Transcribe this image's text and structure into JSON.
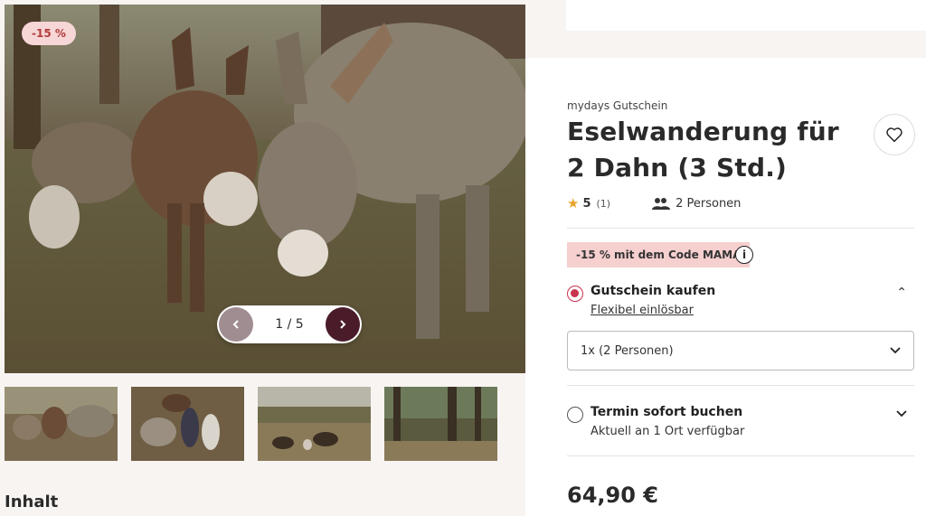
{
  "gallery": {
    "badge": "-15 %",
    "counter": "1 / 5",
    "prev_icon": "chevron-left-icon",
    "next_icon": "chevron-right-icon",
    "thumbnails": [
      "donkeys-grazing",
      "people-with-donkeys",
      "donkeys-in-field",
      "forest-path"
    ]
  },
  "content": {
    "section_title": "Inhalt"
  },
  "product": {
    "brand": "mydays Gutschein",
    "title": "Eselwanderung für 2 Dahn (3 Std.)",
    "wishlist_icon": "heart-icon",
    "rating_value": "5",
    "rating_count": "(1)",
    "persons": "2 Personen",
    "promo": "-15 % mit dem Code MAMA",
    "option_voucher": {
      "label": "Gutschein kaufen",
      "sublabel": "Flexibel einlösbar",
      "selected": true
    },
    "quantity_select": "1x (2 Personen)",
    "option_booking": {
      "label": "Termin sofort buchen",
      "sublabel": "Aktuell an 1 Ort verfügbar",
      "selected": false
    },
    "price": "64,90 €"
  },
  "colors": {
    "accent": "#c8344d",
    "promo_bg": "#f6cfcf",
    "pager_next": "#4a1c2a"
  }
}
